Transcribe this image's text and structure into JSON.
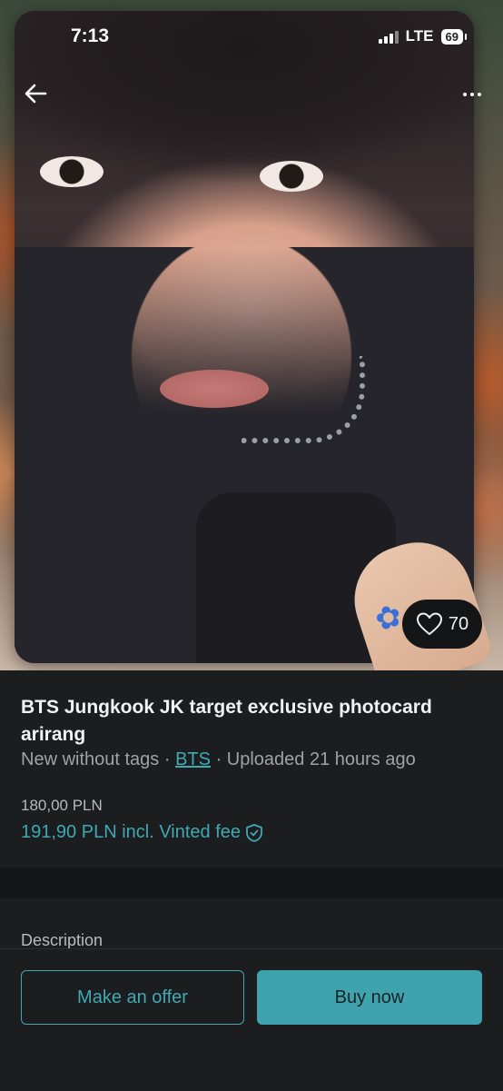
{
  "status_bar": {
    "time": "7:13",
    "network": "LTE",
    "battery": "69"
  },
  "photo": {
    "favourites_count": "70"
  },
  "item": {
    "title": "BTS Jungkook JK target exclusive photocard arirang",
    "condition": "New without tags",
    "separator": "·",
    "brand": "BTS",
    "uploaded": "Uploaded 21 hours ago",
    "price": "180,00 PLN",
    "price_with_fee": "191,90 PLN incl. Vinted fee"
  },
  "description": {
    "label": "Description"
  },
  "actions": {
    "offer_label": "Make an offer",
    "buy_label": "Buy now"
  },
  "colors": {
    "accent": "#3fa9b4",
    "background": "#1b1d1e"
  }
}
